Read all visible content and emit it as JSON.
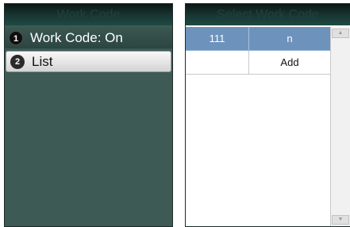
{
  "left": {
    "title": "Work Code",
    "items": [
      {
        "badge": "1",
        "label": "Work Code: On"
      },
      {
        "badge": "2",
        "label": "List"
      }
    ]
  },
  "right": {
    "title": "Select Work Code",
    "rows": [
      {
        "code": "111",
        "name": "n"
      },
      {
        "code": "",
        "name": "Add"
      }
    ],
    "scroll_up_glyph": "▲",
    "scroll_down_glyph": "▼"
  },
  "colors": {
    "screen_bg": "#3d5a55",
    "titlebar": "#16322e",
    "selected_row": "#6d93bd",
    "highlight_item": "#e6e6e6"
  }
}
